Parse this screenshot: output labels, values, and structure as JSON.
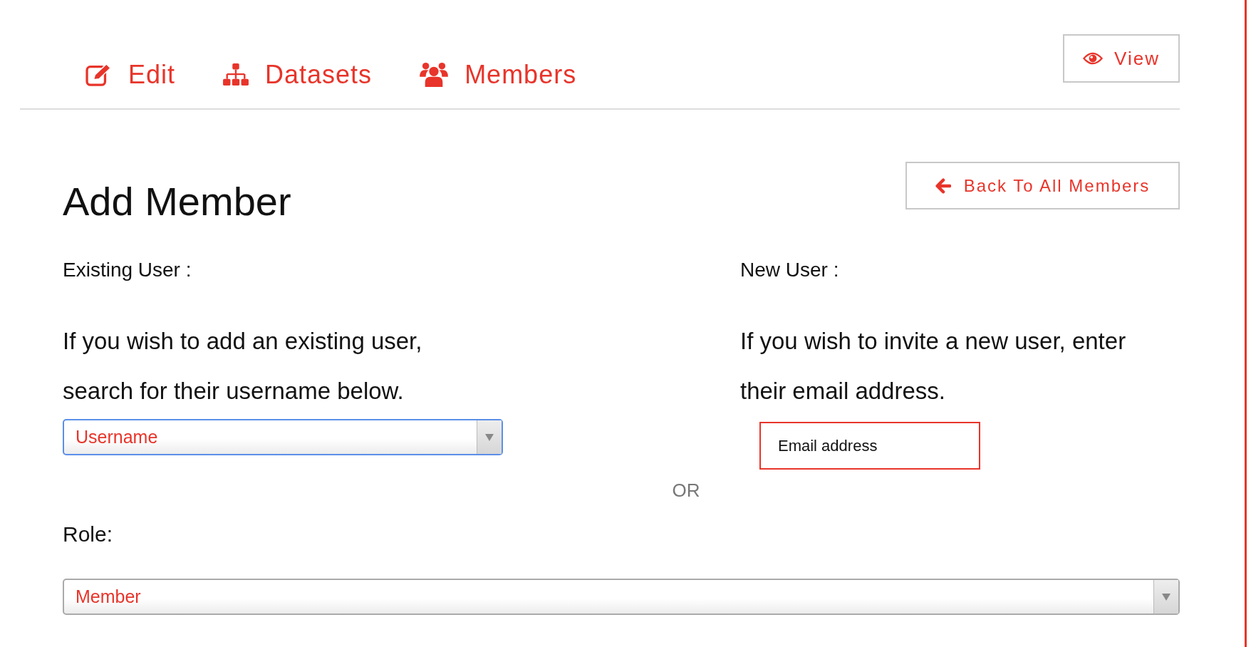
{
  "nav": {
    "tabs": [
      {
        "label": "Edit"
      },
      {
        "label": "Datasets"
      },
      {
        "label": "Members"
      }
    ],
    "view_button": "View"
  },
  "header": {
    "title": "Add Member",
    "back_button": "Back To All Members"
  },
  "existing_user": {
    "label": "Existing User :",
    "text": "If you wish to add an existing user,\nsearch for their username below.",
    "select": {
      "value": "Username",
      "focused": true
    }
  },
  "new_user": {
    "label": "New User :",
    "text": "If you wish to invite a new user, enter\ntheir email address.",
    "email": {
      "placeholder": "Email address"
    }
  },
  "separator": "OR",
  "role": {
    "label": "Role:",
    "select": {
      "value": "Member",
      "focused": false
    }
  }
}
